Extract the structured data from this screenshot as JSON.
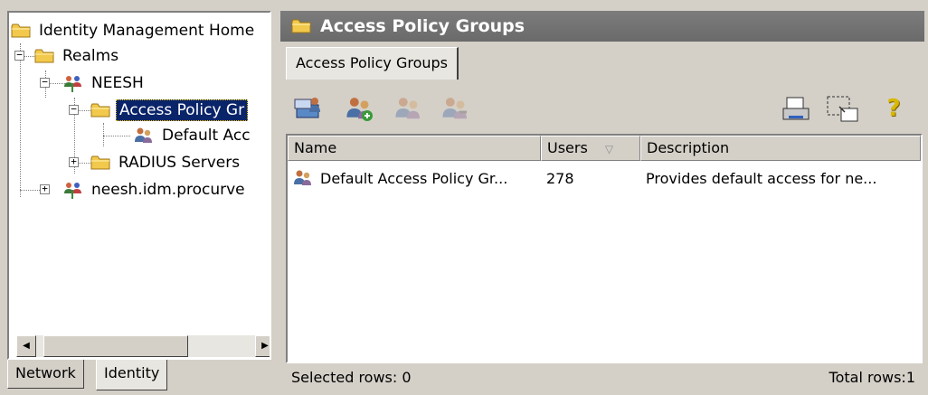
{
  "tree": {
    "home_label": "Identity Management Home",
    "realms_label": "Realms",
    "neesh_label": "NEESH",
    "access_policy_groups_label": "Access Policy Gr",
    "default_access_label": "Default Acc",
    "radius_servers_label": "RADIUS Servers",
    "neesh_idm_label": "neesh.idm.procurve"
  },
  "left_tabs": {
    "network_label": "Network",
    "identity_label": "Identity"
  },
  "right": {
    "title": "Access Policy Groups",
    "tab_label": "Access Policy Groups",
    "toolbar_icons": [
      "open-folder-icon",
      "add-group-icon",
      "edit-group-icon",
      "delete-group-icon",
      "print-icon",
      "select-region-icon",
      "help-icon"
    ],
    "help_glyph": "?"
  },
  "table": {
    "columns": [
      {
        "label": "Name"
      },
      {
        "label": "Users",
        "sort_glyph": "▽"
      },
      {
        "label": "Description"
      }
    ],
    "rows": [
      {
        "name": "Default Access Policy Gr...",
        "users": "278",
        "description": "Provides default access for ne..."
      }
    ]
  },
  "status": {
    "selected_rows": "Selected rows: 0",
    "total_rows": "Total rows:1"
  },
  "colors": {
    "selection": "#0a246a",
    "title_bar": "#707070",
    "folder": "#f2c94c"
  }
}
